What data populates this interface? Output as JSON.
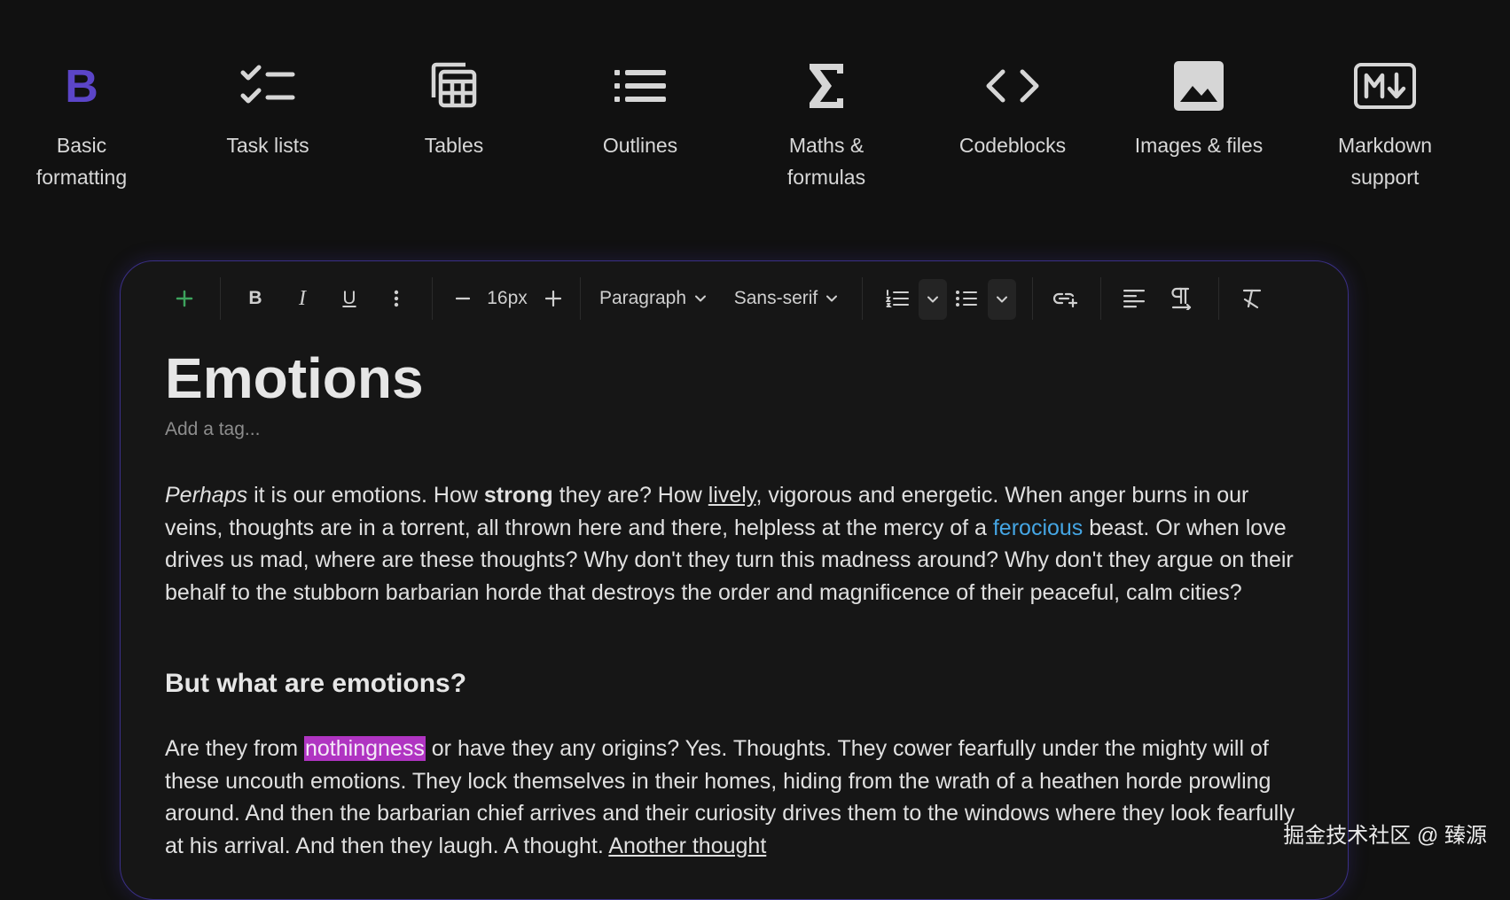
{
  "features": [
    {
      "name": "bold-icon",
      "label": "Basic\nformatting"
    },
    {
      "name": "task-list-icon",
      "label": "Task lists"
    },
    {
      "name": "table-icon",
      "label": "Tables"
    },
    {
      "name": "outline-list-icon",
      "label": "Outlines"
    },
    {
      "name": "sigma-icon",
      "label": "Maths &\nformulas"
    },
    {
      "name": "code-icon",
      "label": "Codeblocks"
    },
    {
      "name": "image-icon",
      "label": "Images & files"
    },
    {
      "name": "markdown-icon",
      "label": "Markdown\nsupport"
    }
  ],
  "toolbar": {
    "bold_glyph": "B",
    "italic_glyph": "I",
    "underline_glyph": "U",
    "font_size": "16px",
    "block_style": "Paragraph",
    "font_family": "Sans-serif"
  },
  "document": {
    "title": "Emotions",
    "tag_placeholder": "Add a tag...",
    "p1": {
      "italic": "Perhaps",
      "t1": " it is our emotions. How ",
      "bold": "strong",
      "t2": " they are? How ",
      "underlined": "lively",
      "t3": ", vigorous and energetic. When anger burns in our veins, thoughts are in a torrent, all thrown here and there, helpless at the mercy of a ",
      "link": "ferocious",
      "t4": " beast. Or when love drives us mad, where are these thoughts? Why don't they turn this madness around? Why don't they argue on their behalf to the stubborn barbarian horde that destroys the order and magnificence of their peaceful, calm cities?"
    },
    "heading": "But what are emotions?",
    "p2": {
      "t1": "Are they from ",
      "highlight": "nothingness",
      "t2": " or have they any origins? Yes. Thoughts. They cower fearfully under the mighty will of these uncouth emotions. They lock themselves in their homes, hiding from the wrath of a heathen horde prowling around. And then the barbarian chief arrives and their curiosity drives them to the windows where they look fearfully at his arrival. And then they laugh. A thought. ",
      "underlined_end": "Another thought"
    }
  },
  "watermark": "掘金技术社区 @ 臻源",
  "colors": {
    "background": "#111111",
    "editor_border": "#3a2f86",
    "bold_icon": "#5b45c8",
    "add_button": "#3da35d",
    "link": "#45a6e4",
    "highlight": "#b034c2"
  }
}
